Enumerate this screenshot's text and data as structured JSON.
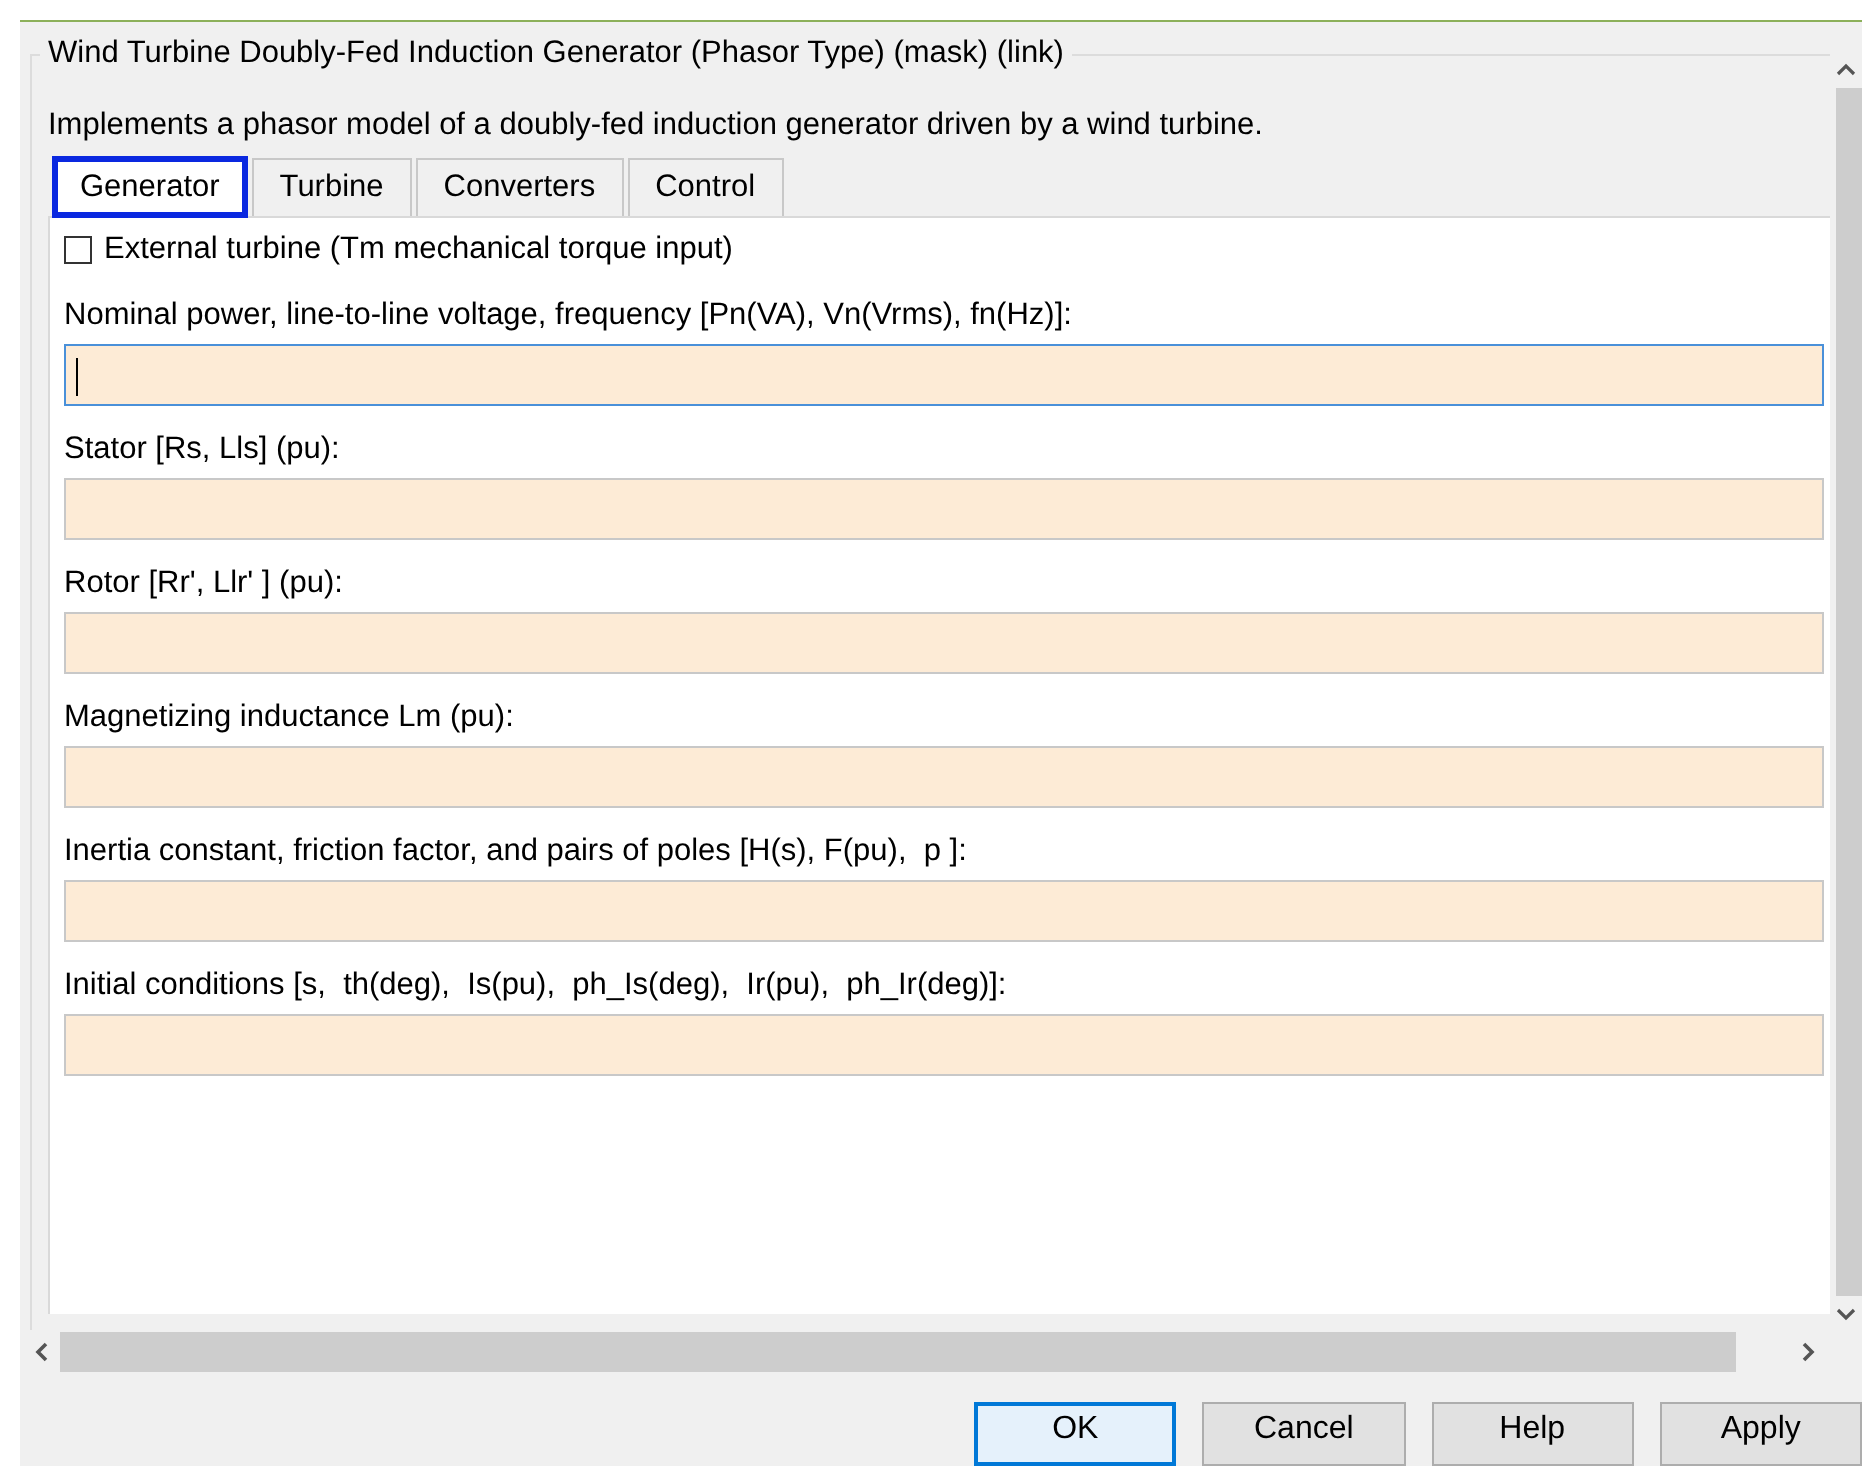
{
  "dialog": {
    "title": "Wind Turbine Doubly-Fed Induction Generator (Phasor Type) (mask) (link)",
    "description": "Implements a phasor model of a doubly-fed induction generator driven by a wind turbine."
  },
  "tabs": [
    {
      "label": "Generator",
      "selected": true
    },
    {
      "label": "Turbine",
      "selected": false
    },
    {
      "label": "Converters",
      "selected": false
    },
    {
      "label": "Control",
      "selected": false
    }
  ],
  "options": [
    {
      "label": "External turbine (Tm mechanical torque input)",
      "checked": false
    }
  ],
  "parameters": [
    {
      "label": "Nominal power, line-to-line voltage, frequency [Pn(VA), Vn(Vrms), fn(Hz)]:",
      "focused": true
    },
    {
      "label": "Stator [Rs, Lls] (pu):",
      "focused": false
    },
    {
      "label": "Rotor [Rr', Llr' ] (pu):",
      "focused": false
    },
    {
      "label": "Magnetizing inductance Lm (pu):",
      "focused": false
    },
    {
      "label": "Inertia constant, friction factor, and pairs of poles [H(s), F(pu),  p ]:",
      "focused": false
    },
    {
      "label": "Initial conditions [s,  th(deg),  Is(pu),  ph_Is(deg),  Ir(pu),  ph_Ir(deg)]:",
      "focused": false
    }
  ],
  "buttons": [
    {
      "label": "OK",
      "focused": true
    },
    {
      "label": "Cancel",
      "focused": false
    },
    {
      "label": "Help",
      "focused": false
    },
    {
      "label": "Apply",
      "focused": false
    }
  ]
}
